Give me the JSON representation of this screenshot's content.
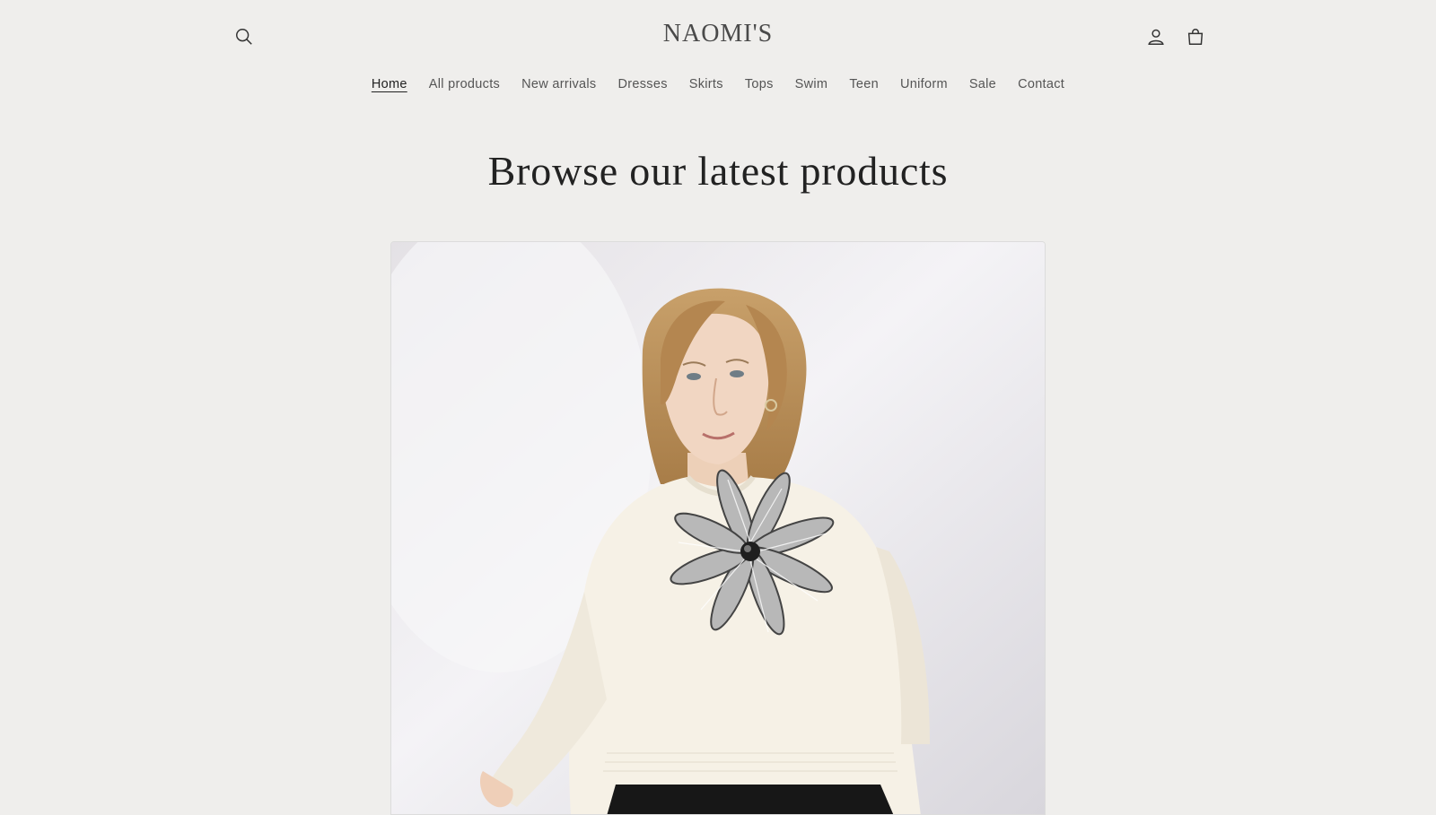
{
  "header": {
    "store_name": "NAOMI'S",
    "icons": {
      "search": "search-icon",
      "account": "account-icon",
      "cart": "cart-icon"
    }
  },
  "nav": {
    "items": [
      {
        "label": "Home",
        "active": true
      },
      {
        "label": "All products",
        "active": false
      },
      {
        "label": "New arrivals",
        "active": false
      },
      {
        "label": "Dresses",
        "active": false
      },
      {
        "label": "Skirts",
        "active": false
      },
      {
        "label": "Tops",
        "active": false
      },
      {
        "label": "Swim",
        "active": false
      },
      {
        "label": "Teen",
        "active": false
      },
      {
        "label": "Uniform",
        "active": false
      },
      {
        "label": "Sale",
        "active": false
      },
      {
        "label": "Contact",
        "active": false
      }
    ]
  },
  "main": {
    "headline": "Browse our latest products"
  },
  "colors": {
    "background": "#efeeec",
    "text": "#2b2b2b",
    "sweater": "#f6f1e6"
  }
}
